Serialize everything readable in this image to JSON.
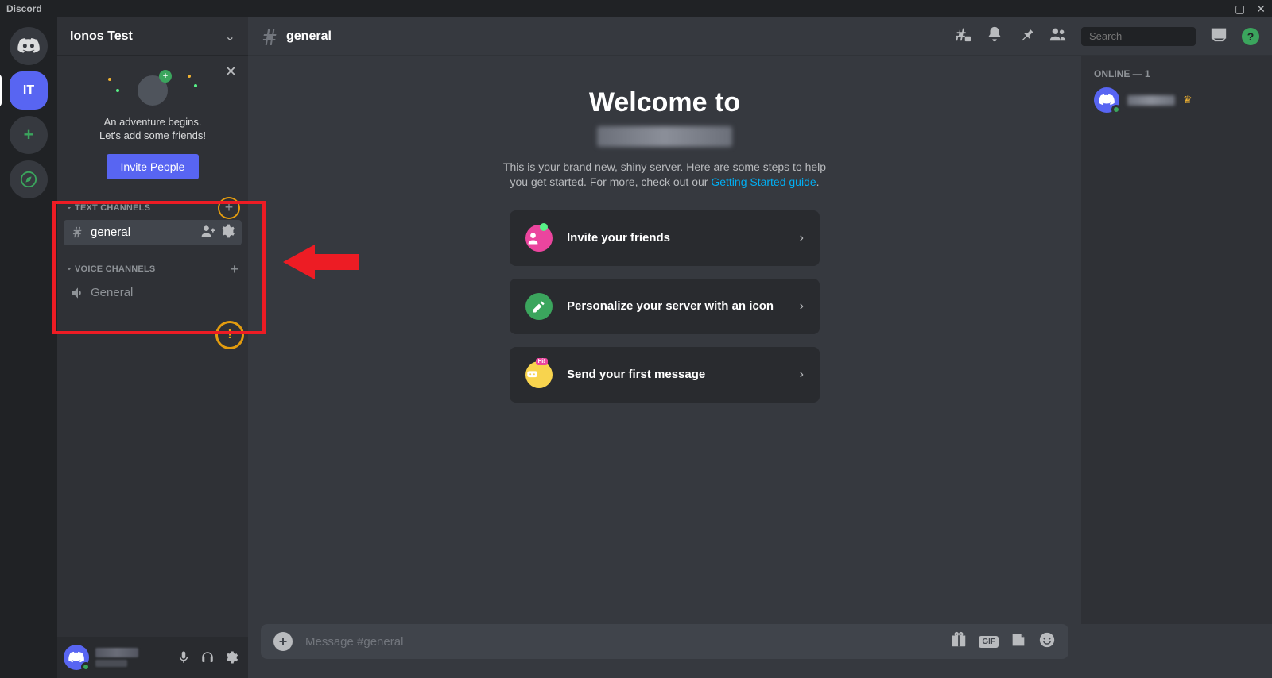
{
  "app_name": "Discord",
  "server_list": {
    "active_server_abbrev": "IT"
  },
  "sidebar": {
    "server_name": "Ionos Test",
    "invite": {
      "line1": "An adventure begins.",
      "line2": "Let's add some friends!",
      "button": "Invite People"
    },
    "categories": [
      {
        "name": "TEXT CHANNELS",
        "channels": [
          {
            "name": "general",
            "type": "text",
            "active": true
          }
        ]
      },
      {
        "name": "VOICE CHANNELS",
        "channels": [
          {
            "name": "General",
            "type": "voice",
            "active": false
          }
        ]
      }
    ]
  },
  "chat_header": {
    "channel_name": "general",
    "search_placeholder": "Search"
  },
  "welcome": {
    "title": "Welcome to",
    "desc_pre": "This is your brand new, shiny server. Here are some steps to help you get started. For more, check out our ",
    "desc_link": "Getting Started guide",
    "desc_post": ".",
    "cards": [
      {
        "label": "Invite your friends",
        "icon_bg": "#eb459e"
      },
      {
        "label": "Personalize your server with an icon",
        "icon_bg": "#3ba55d"
      },
      {
        "label": "Send your first message",
        "icon_bg": "#f8d44e"
      }
    ]
  },
  "members": {
    "heading": "ONLINE — 1"
  },
  "input": {
    "placeholder": "Message #general"
  },
  "user_controls": {
    "mic": "mic-icon",
    "headphones": "headphones-icon",
    "settings": "gear-icon"
  }
}
